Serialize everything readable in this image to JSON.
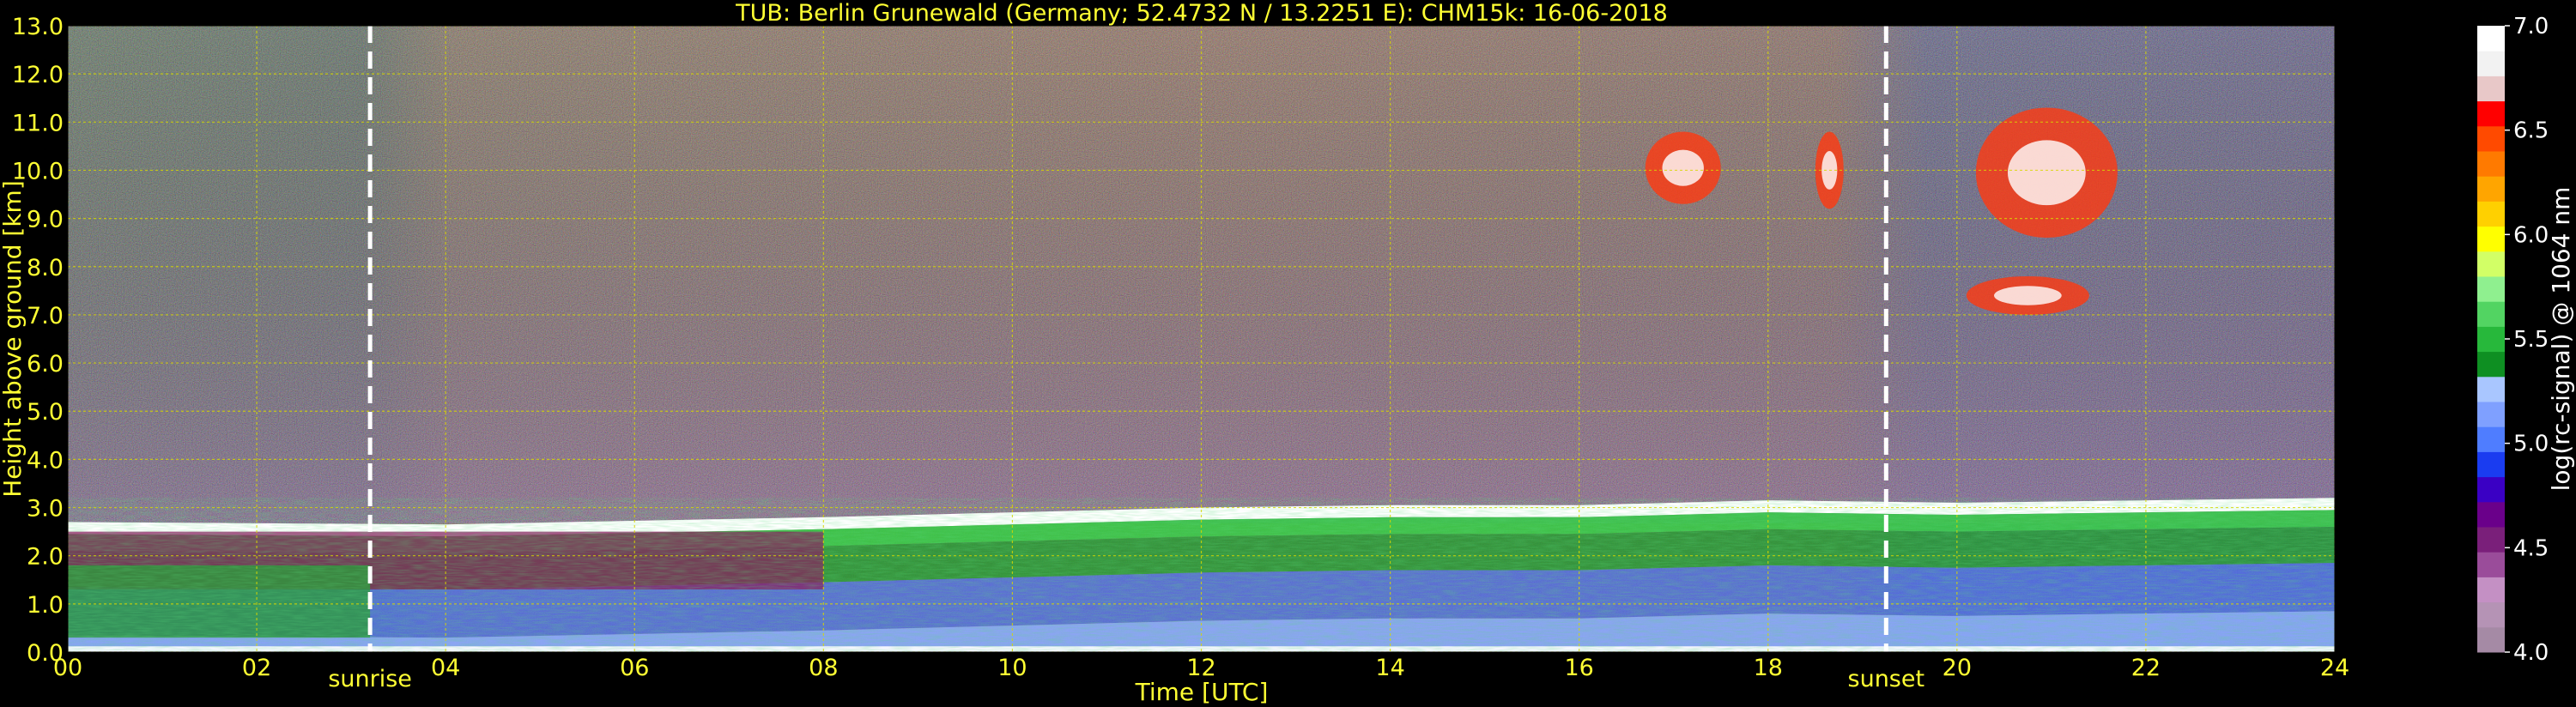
{
  "chart_data": {
    "type": "heatmap",
    "title": "TUB: Berlin Grunewald (Germany; 52.4732 N / 13.2251 E):    CHM15k: 16-06-2018",
    "xlabel": "Time [UTC]",
    "ylabel": "Height above ground [km]",
    "colorbar_label": "log(rc-signal) @ 1064 nm",
    "xlim": [
      0,
      24
    ],
    "ylim": [
      0,
      13
    ],
    "xticks": [
      "00",
      "02",
      "04",
      "06",
      "08",
      "10",
      "12",
      "14",
      "16",
      "18",
      "20",
      "22",
      "24"
    ],
    "yticks": [
      "0.0",
      "1.0",
      "2.0",
      "3.0",
      "4.0",
      "5.0",
      "6.0",
      "7.0",
      "8.0",
      "9.0",
      "10.0",
      "11.0",
      "12.0",
      "13.0"
    ],
    "colorbar_range": [
      4.0,
      7.0
    ],
    "colorbar_ticks": [
      "4.0",
      "4.5",
      "5.0",
      "5.5",
      "6.0",
      "6.5",
      "7.0"
    ],
    "grid": true,
    "events": [
      {
        "label": "sunrise",
        "time": 3.2
      },
      {
        "label": "sunset",
        "time": 19.25
      }
    ],
    "features": {
      "boundary_layer_top_km": [
        {
          "time": 0,
          "height": 2.65
        },
        {
          "time": 4,
          "height": 2.6
        },
        {
          "time": 8,
          "height": 2.75
        },
        {
          "time": 10,
          "height": 2.85
        },
        {
          "time": 12,
          "height": 2.95
        },
        {
          "time": 14,
          "height": 3.0
        },
        {
          "time": 16,
          "height": 3.0
        },
        {
          "time": 18,
          "height": 3.1
        },
        {
          "time": 20,
          "height": 3.05
        },
        {
          "time": 24,
          "height": 3.15
        }
      ],
      "cirrus_clouds_km": [
        {
          "start": 16.7,
          "end": 17.5,
          "base": 9.3,
          "top": 10.8
        },
        {
          "start": 18.5,
          "end": 18.8,
          "base": 9.2,
          "top": 10.8
        },
        {
          "start": 20.2,
          "end": 21.7,
          "base": 8.6,
          "top": 11.3
        },
        {
          "start": 20.1,
          "end": 21.4,
          "base": 7.0,
          "top": 7.8
        }
      ]
    }
  },
  "colors": {
    "text": "#ffff33",
    "grid": "#d8d800",
    "event_line": "#ffffff",
    "colormap": [
      "#a58aa5",
      "#b593b5",
      "#c490c4",
      "#9a4c9a",
      "#7a1f7a",
      "#6a008a",
      "#3a00c4",
      "#1a3cf0",
      "#4f7dff",
      "#7fa0ff",
      "#a9c6ff",
      "#0e8f22",
      "#27b83b",
      "#52d462",
      "#8ff08f",
      "#d2ff66",
      "#ffff00",
      "#ffd000",
      "#ffa500",
      "#ff7a00",
      "#ff4a00",
      "#ff0000",
      "#e8c8c8",
      "#f2f2f2",
      "#ffffff"
    ]
  }
}
